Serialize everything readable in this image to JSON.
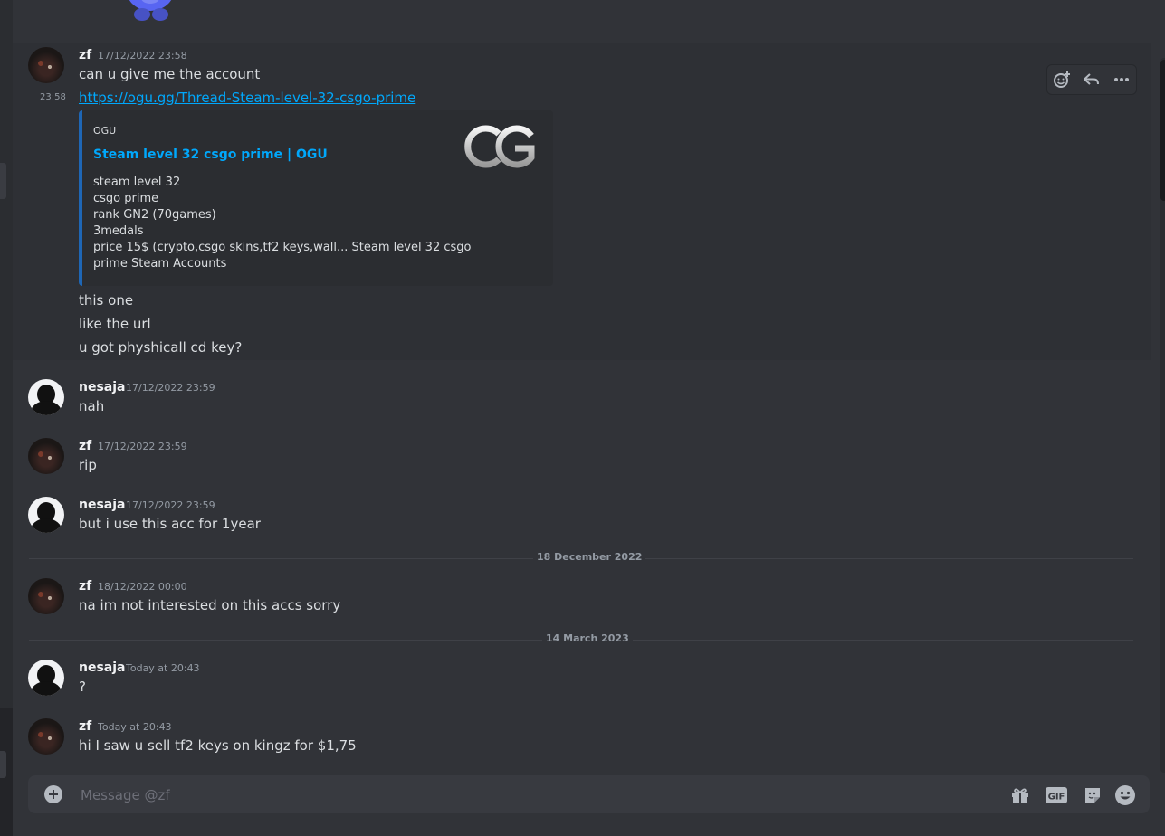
{
  "recipient": "zf",
  "composer": {
    "placeholder": "Message @zf"
  },
  "toolbar": {
    "icons": [
      "add-reaction-icon",
      "reply-icon",
      "more-icon"
    ]
  },
  "dividers": [
    {
      "label": "18 December 2022"
    },
    {
      "label": "14 March 2023"
    }
  ],
  "messages": [
    {
      "author": "zf",
      "timestamp": "17/12/2022 23:58",
      "lines": [
        "can u give me the account"
      ]
    },
    {
      "hover_time": "23:58",
      "link": "https://ogu.gg/Thread-Steam-level-32-csgo-prime"
    },
    {
      "lines": [
        "this one",
        "like the url",
        "u got physhicall cd key?"
      ]
    },
    {
      "author": "nesaja",
      "timestamp": "17/12/2022 23:59",
      "lines": [
        "nah"
      ]
    },
    {
      "author": "zf",
      "timestamp": "17/12/2022 23:59",
      "lines": [
        "rip"
      ]
    },
    {
      "author": "nesaja",
      "timestamp": "17/12/2022 23:59",
      "lines": [
        "but i use this acc for 1year"
      ]
    },
    {
      "author": "zf",
      "timestamp": "18/12/2022 00:00",
      "lines": [
        "na im not interested on this accs sorry"
      ]
    },
    {
      "author": "nesaja",
      "timestamp": "Today at 20:43",
      "lines": [
        "?"
      ]
    },
    {
      "author": "zf",
      "timestamp": "Today at 20:43",
      "lines": [
        "hi I saw u sell tf2 keys on kingz for $1,75"
      ]
    }
  ],
  "embed": {
    "provider": "OGU",
    "title": "Steam level 32 csgo prime | OGU",
    "thumbnail_text": "OG",
    "description": [
      "steam level 32",
      "csgo prime",
      "rank GN2 (70games)",
      "3medals",
      "price 15$ (crypto,csgo skins,tf2 keys,wall... Steam level 32 csgo",
      "prime Steam Accounts"
    ]
  },
  "composer_icons": [
    "gift-icon",
    "gif-icon",
    "sticker-icon",
    "emoji-icon"
  ],
  "colors": {
    "background": "#313338",
    "link": "#00a8fc",
    "embed_border": "#1e66b5"
  }
}
